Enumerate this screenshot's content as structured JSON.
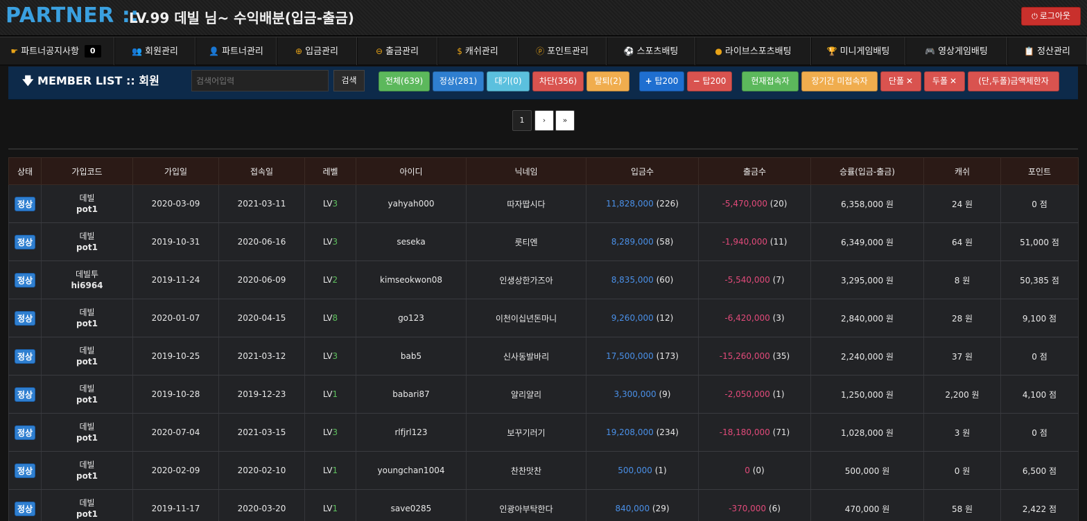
{
  "header": {
    "brand": "PARTNER ::",
    "title": "LV.99 데빌 님~ 수익배분(입금-출금)",
    "logout_label": "로그아웃",
    "logout_icon": "power-icon"
  },
  "nav": [
    {
      "label": "파트너공지사항",
      "icon": "hand-point-icon",
      "badge": "0"
    },
    {
      "label": "회원관리",
      "icon": "users-icon"
    },
    {
      "label": "파트너관리",
      "icon": "user-plus-icon"
    },
    {
      "label": "입금관리",
      "icon": "plus-circle-icon"
    },
    {
      "label": "출금관리",
      "icon": "minus-circle-icon"
    },
    {
      "label": "캐쉬관리",
      "icon": "dollar-icon"
    },
    {
      "label": "포인트관리",
      "icon": "p-circle-icon"
    },
    {
      "label": "스포츠배팅",
      "icon": "soccer-ball-icon"
    },
    {
      "label": "라이브스포츠배팅",
      "icon": "basketball-icon"
    },
    {
      "label": "미니게임배팅",
      "icon": "trophy-icon"
    },
    {
      "label": "영상게임배팅",
      "icon": "gamepad-icon"
    },
    {
      "label": "정산관리",
      "icon": "clipboard-icon"
    }
  ],
  "actionbar": {
    "title": "MEMBER LIST :: 회원",
    "search_placeholder": "검색어입력",
    "search_button": "검색",
    "filters": {
      "all": "전체(639)",
      "normal": "정상(281)",
      "waiting": "대기(0)",
      "blocked": "차단(356)",
      "withdrawn": "탈퇴(2)"
    },
    "top_plus": "탑200",
    "top_minus": "탑200",
    "online": "현재접속자",
    "long_absent": "장기간 미접속자",
    "single_x": "단폴",
    "double_x": "두폴",
    "limit": "(단,두폴)금액제한자"
  },
  "pagination": {
    "current": "1",
    "next": "›",
    "last": "»"
  },
  "table": {
    "headers": [
      "상태",
      "가입코드",
      "가입일",
      "접속일",
      "레벨",
      "아이디",
      "닉네임",
      "입금수",
      "출금수",
      "승률(입금-출금)",
      "캐쉬",
      "포인트"
    ],
    "rows": [
      {
        "status": "정상",
        "code1": "데빌",
        "code2": "pot1",
        "join": "2020-03-09",
        "access": "2021-03-11",
        "lv": "LV",
        "lvnum": "3",
        "id": "yahyah000",
        "nick": "따자땁시다",
        "dep": "11,828,000",
        "depcnt": "(226)",
        "wd": "-5,470,000",
        "wdcnt": "(20)",
        "rate": "6,358,000 원",
        "cash": "24 원",
        "point": "0 점"
      },
      {
        "status": "정상",
        "code1": "데빌",
        "code2": "pot1",
        "join": "2019-10-31",
        "access": "2020-06-16",
        "lv": "LV",
        "lvnum": "3",
        "id": "seseka",
        "nick": "룻티엔",
        "dep": "8,289,000",
        "depcnt": "(58)",
        "wd": "-1,940,000",
        "wdcnt": "(11)",
        "rate": "6,349,000 원",
        "cash": "64 원",
        "point": "51,000 점"
      },
      {
        "status": "정상",
        "code1": "데빌투",
        "code2": "hi6964",
        "join": "2019-11-24",
        "access": "2020-06-09",
        "lv": "LV",
        "lvnum": "2",
        "id": "kimseokwon08",
        "nick": "인생상한가즈아",
        "dep": "8,835,000",
        "depcnt": "(60)",
        "wd": "-5,540,000",
        "wdcnt": "(7)",
        "rate": "3,295,000 원",
        "cash": "8 원",
        "point": "50,385 점"
      },
      {
        "status": "정상",
        "code1": "데빌",
        "code2": "pot1",
        "join": "2020-01-07",
        "access": "2020-04-15",
        "lv": "LV",
        "lvnum": "8",
        "id": "go123",
        "nick": "이천이십년돈마니",
        "dep": "9,260,000",
        "depcnt": "(12)",
        "wd": "-6,420,000",
        "wdcnt": "(3)",
        "rate": "2,840,000 원",
        "cash": "28 원",
        "point": "9,100 점"
      },
      {
        "status": "정상",
        "code1": "데빌",
        "code2": "pot1",
        "join": "2019-10-25",
        "access": "2021-03-12",
        "lv": "LV",
        "lvnum": "3",
        "id": "bab5",
        "nick": "신사동발바리",
        "dep": "17,500,000",
        "depcnt": "(173)",
        "wd": "-15,260,000",
        "wdcnt": "(35)",
        "rate": "2,240,000 원",
        "cash": "37 원",
        "point": "0 점"
      },
      {
        "status": "정상",
        "code1": "데빌",
        "code2": "pot1",
        "join": "2019-10-28",
        "access": "2019-12-23",
        "lv": "LV",
        "lvnum": "1",
        "id": "babari87",
        "nick": "얄리얄리",
        "dep": "3,300,000",
        "depcnt": "(9)",
        "wd": "-2,050,000",
        "wdcnt": "(1)",
        "rate": "1,250,000 원",
        "cash": "2,200 원",
        "point": "4,100 점"
      },
      {
        "status": "정상",
        "code1": "데빌",
        "code2": "pot1",
        "join": "2020-07-04",
        "access": "2021-03-15",
        "lv": "LV",
        "lvnum": "3",
        "id": "rlfjrl123",
        "nick": "보꾸기러기",
        "dep": "19,208,000",
        "depcnt": "(234)",
        "wd": "-18,180,000",
        "wdcnt": "(71)",
        "rate": "1,028,000 원",
        "cash": "3 원",
        "point": "0 점"
      },
      {
        "status": "정상",
        "code1": "데빌",
        "code2": "pot1",
        "join": "2020-02-09",
        "access": "2020-02-10",
        "lv": "LV",
        "lvnum": "1",
        "id": "youngchan1004",
        "nick": "찬찬맛찬",
        "dep": "500,000",
        "depcnt": "(1)",
        "wd": "0",
        "wdcnt": "(0)",
        "rate": "500,000 원",
        "cash": "0 원",
        "point": "6,500 점"
      },
      {
        "status": "정상",
        "code1": "데빌",
        "code2": "pot1",
        "join": "2019-11-17",
        "access": "2020-03-20",
        "lv": "LV",
        "lvnum": "1",
        "id": "save0285",
        "nick": "인광아부탁한다",
        "dep": "840,000",
        "depcnt": "(29)",
        "wd": "-370,000",
        "wdcnt": "(6)",
        "rate": "470,000 원",
        "cash": "58 원",
        "point": "2,422 점"
      }
    ]
  }
}
